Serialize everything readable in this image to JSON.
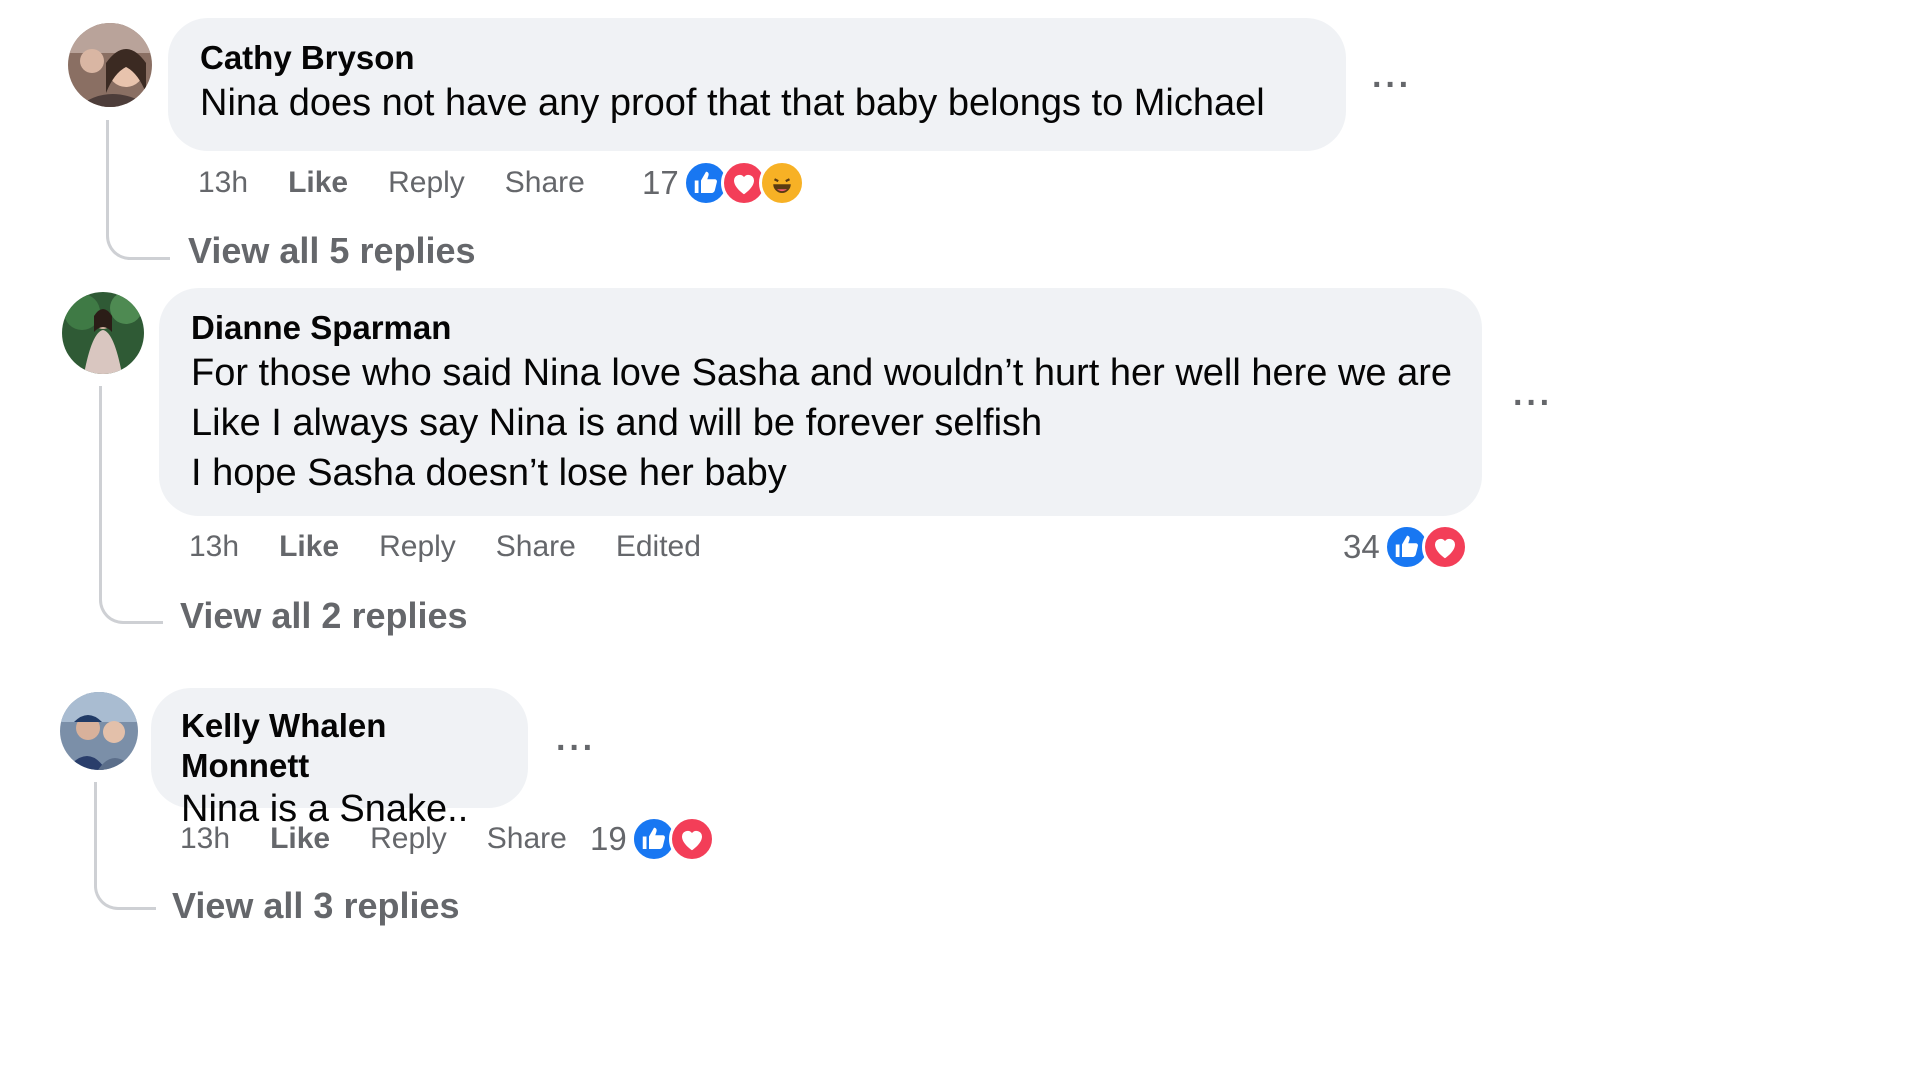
{
  "comments": [
    {
      "author": "Cathy Bryson",
      "lines": [
        "Nina does not have any proof that that baby belongs to Michael"
      ],
      "time": "13h",
      "like": "Like",
      "reply": "Reply",
      "share": "Share",
      "edited": "",
      "reaction_count": "17",
      "reactions": [
        "like",
        "love",
        "haha"
      ],
      "view_replies": "View all 5 replies",
      "more": "···"
    },
    {
      "author": "Dianne Sparman",
      "lines": [
        "For those who said Nina love Sasha and wouldn’t hurt her well here we are",
        "Like I always say Nina is and will be forever selfish",
        "I hope Sasha doesn’t lose her baby"
      ],
      "time": "13h",
      "like": "Like",
      "reply": "Reply",
      "share": "Share",
      "edited": "Edited",
      "reaction_count": "34",
      "reactions": [
        "like",
        "love"
      ],
      "view_replies": "View all 2 replies",
      "more": "···"
    },
    {
      "author": "Kelly Whalen Monnett",
      "lines": [
        "Nina is a Snake.."
      ],
      "time": "13h",
      "like": "Like",
      "reply": "Reply",
      "share": "Share",
      "edited": "",
      "reaction_count": "19",
      "reactions": [
        "like",
        "love"
      ],
      "view_replies": "View all 3 replies",
      "more": "···"
    }
  ],
  "colors": {
    "like": "#1877f2",
    "love": "#f33e58",
    "haha": "#f7b125",
    "bubble": "#f0f2f5",
    "muted": "#65676b"
  }
}
